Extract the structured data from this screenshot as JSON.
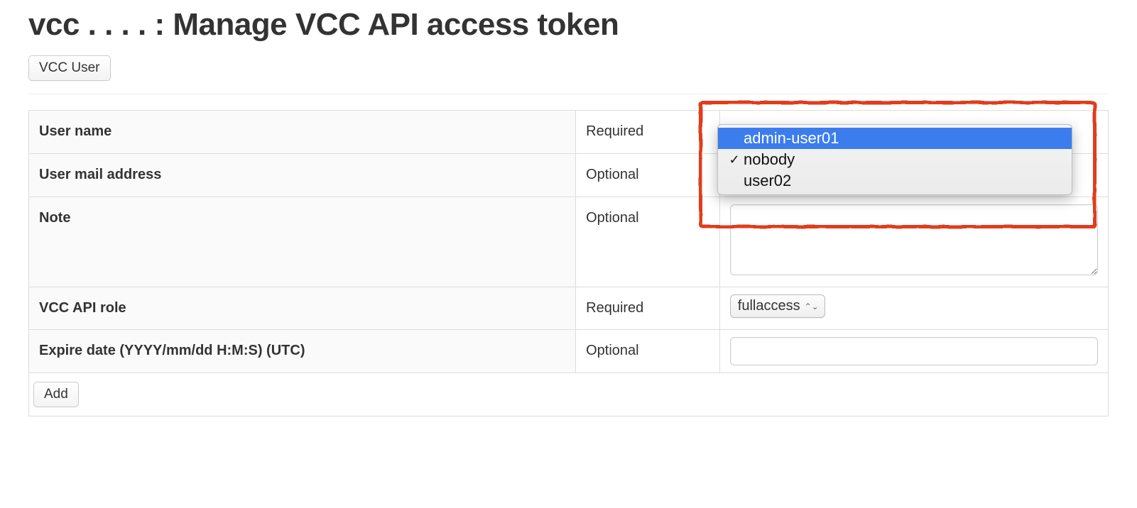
{
  "header": {
    "title_prefix": "vcc",
    "title_obscured": " . . . . ",
    "title_suffix": ": Manage VCC API access token"
  },
  "toolbar": {
    "vcc_user_button": "VCC User",
    "add_button": "Add"
  },
  "form": {
    "rows": [
      {
        "label": "User name",
        "requirement": "Required",
        "control": "select-user"
      },
      {
        "label": "User mail address",
        "requirement": "Optional",
        "control": "text"
      },
      {
        "label": "Note",
        "requirement": "Optional",
        "control": "textarea"
      },
      {
        "label": "VCC API role",
        "requirement": "Required",
        "control": "select-role"
      },
      {
        "label": "Expire date (YYYY/mm/dd H:M:S) (UTC)",
        "requirement": "Optional",
        "control": "text"
      }
    ]
  },
  "role_select": {
    "selected": "fullaccess"
  },
  "user_dropdown": {
    "options": [
      {
        "label": "admin-user01",
        "highlighted": true,
        "checked": false
      },
      {
        "label": "nobody",
        "highlighted": false,
        "checked": true
      },
      {
        "label": "user02",
        "highlighted": false,
        "checked": false
      }
    ]
  },
  "colors": {
    "annotation": "#e03c1a",
    "highlight_bg": "#3b7ded"
  }
}
